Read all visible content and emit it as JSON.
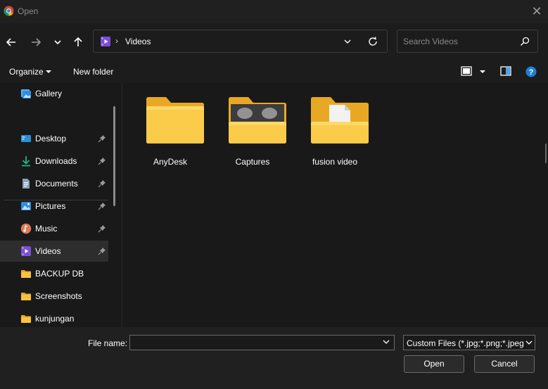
{
  "window": {
    "title": "Open",
    "app_icon": "chrome-icon",
    "close_icon": "close-icon"
  },
  "nav": {
    "back_icon": "back-arrow-icon",
    "forward_icon": "forward-arrow-icon",
    "recent_icon": "chevron-down-icon",
    "up_icon": "up-arrow-icon",
    "address": {
      "separator": "›",
      "location": "Videos",
      "location_icon": "videos-folder-icon"
    },
    "refresh_icon": "refresh-icon",
    "search": {
      "placeholder": "Search Videos",
      "icon": "search-icon"
    }
  },
  "toolbar": {
    "organize_label": "Organize",
    "new_folder_label": "New folder",
    "view_icon": "view-mode-icon",
    "preview_icon": "preview-pane-icon",
    "help_icon": "help-icon"
  },
  "sidebar": {
    "items": [
      {
        "label": "Gallery",
        "icon": "gallery-icon",
        "pinned": false
      },
      {
        "label": "Desktop",
        "icon": "desktop-icon",
        "pinned": true
      },
      {
        "label": "Downloads",
        "icon": "downloads-icon",
        "pinned": true
      },
      {
        "label": "Documents",
        "icon": "documents-icon",
        "pinned": true
      },
      {
        "label": "Pictures",
        "icon": "pictures-icon",
        "pinned": true
      },
      {
        "label": "Music",
        "icon": "music-icon",
        "pinned": true
      },
      {
        "label": "Videos",
        "icon": "videos-icon",
        "pinned": true,
        "selected": true
      },
      {
        "label": "BACKUP DB",
        "icon": "folder-icon",
        "pinned": false
      },
      {
        "label": "Screenshots",
        "icon": "folder-icon",
        "pinned": false
      },
      {
        "label": "kunjungan",
        "icon": "folder-icon",
        "pinned": false
      }
    ]
  },
  "files": [
    {
      "name": "AnyDesk",
      "icon": "folder-icon"
    },
    {
      "name": "Captures",
      "icon": "folder-with-thumbnails-icon"
    },
    {
      "name": "fusion video",
      "icon": "folder-with-document-icon"
    }
  ],
  "bottom": {
    "file_name_label": "File name:",
    "file_name_value": "",
    "file_type_value": "Custom Files (*.jpg;*.png;*.jpeg",
    "open_label": "Open",
    "cancel_label": "Cancel"
  },
  "colors": {
    "background": "#191919",
    "titlebar": "#202020",
    "selected_item": "#2d2d2d",
    "folder_yellow": "#f9c23c",
    "accent_blue": "#1e7fd6",
    "videos_purple": "#7b4fd4"
  }
}
